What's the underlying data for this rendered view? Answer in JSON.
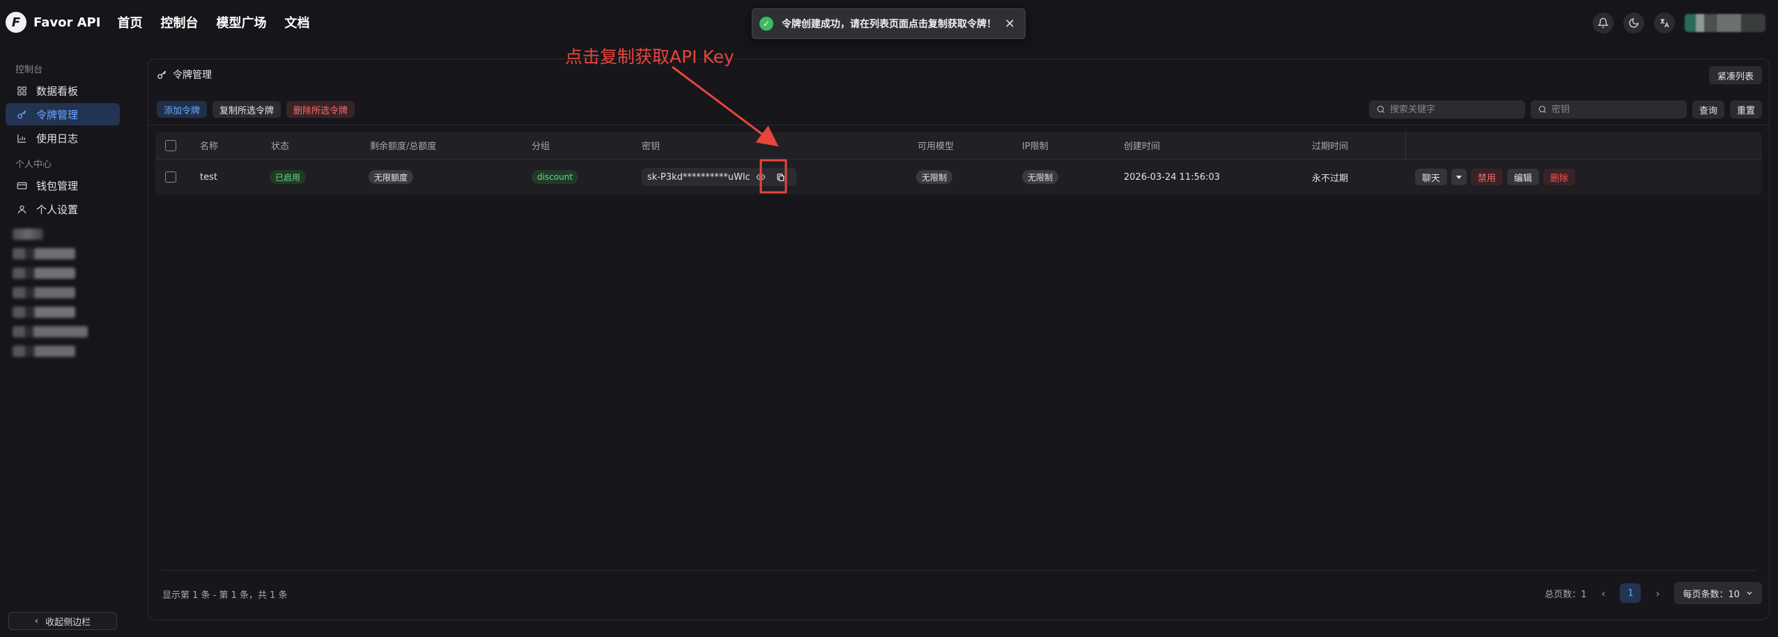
{
  "header": {
    "brand": "Favor API",
    "nav": [
      "首页",
      "控制台",
      "模型广场",
      "文档"
    ]
  },
  "toast": {
    "message": "令牌创建成功，请在列表页面点击复制获取令牌！",
    "close": "✕"
  },
  "annotation": {
    "text": "点击复制获取API Key",
    "color": "#e8453c"
  },
  "sidebar": {
    "section_console": "控制台",
    "section_personal": "个人中心",
    "items": [
      {
        "label": "数据看板",
        "icon": "dashboard-icon"
      },
      {
        "label": "令牌管理",
        "icon": "key-icon",
        "active": true
      },
      {
        "label": "使用日志",
        "icon": "chart-icon"
      },
      {
        "label": "钱包管理",
        "icon": "wallet-icon"
      },
      {
        "label": "个人设置",
        "icon": "user-icon"
      }
    ],
    "collapse_label": "收起侧边栏"
  },
  "panel": {
    "title": "令牌管理",
    "compact_label": "紧凑列表",
    "toolbar": {
      "add": "添加令牌",
      "copy_selected": "复制所选令牌",
      "delete_selected": "删除所选令牌"
    },
    "search": {
      "keyword_placeholder": "搜索关键字",
      "key_placeholder": "密钥",
      "query": "查询",
      "reset": "重置"
    }
  },
  "table": {
    "columns": [
      "名称",
      "状态",
      "剩余额度/总额度",
      "分组",
      "密钥",
      "可用模型",
      "IP限制",
      "创建时间",
      "过期时间"
    ],
    "rows": [
      {
        "name": "test",
        "status": "已启用",
        "quota": "无限额度",
        "group": "discount",
        "key": "sk-P3kd**********uWlc",
        "models": "无限制",
        "ip": "无限制",
        "created": "2026-03-24 11:56:03",
        "expires": "永不过期",
        "actions": {
          "chat": "聊天",
          "disable": "禁用",
          "edit": "编辑",
          "delete": "删除"
        }
      }
    ]
  },
  "footer": {
    "summary": "显示第 1 条 - 第 1 条，共 1 条",
    "total_pages": "总页数：1",
    "current_page": "1",
    "page_size": "每页条数：10"
  },
  "colors": {
    "accent": "#6aa8ff",
    "success": "#3cbb62",
    "danger": "#f36d6d",
    "background": "#16161a"
  }
}
